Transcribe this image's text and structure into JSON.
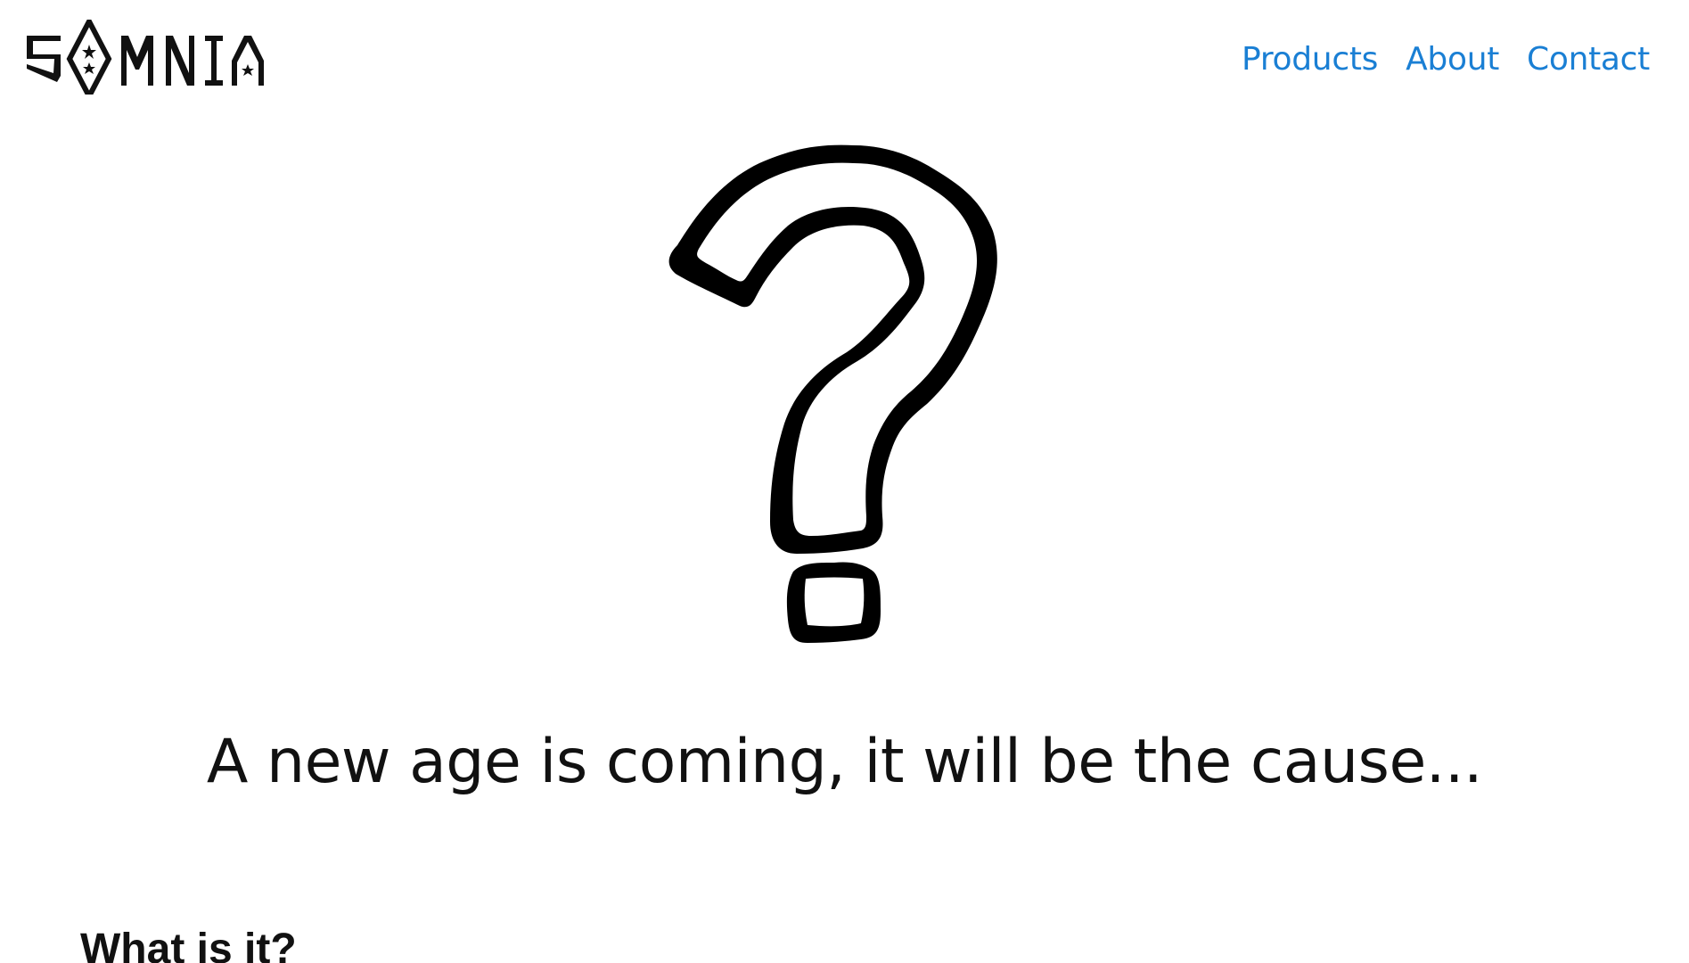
{
  "header": {
    "logo_text": "SOMNIA",
    "nav": [
      {
        "label": "Products"
      },
      {
        "label": "About"
      },
      {
        "label": "Contact"
      }
    ]
  },
  "hero": {
    "image_icon": "question-mark-icon",
    "tagline": "A new age is coming, it will be the cause..."
  },
  "section": {
    "heading": "What is it?"
  },
  "colors": {
    "link": "#1a7fd4",
    "text": "#111111",
    "background": "#ffffff"
  }
}
